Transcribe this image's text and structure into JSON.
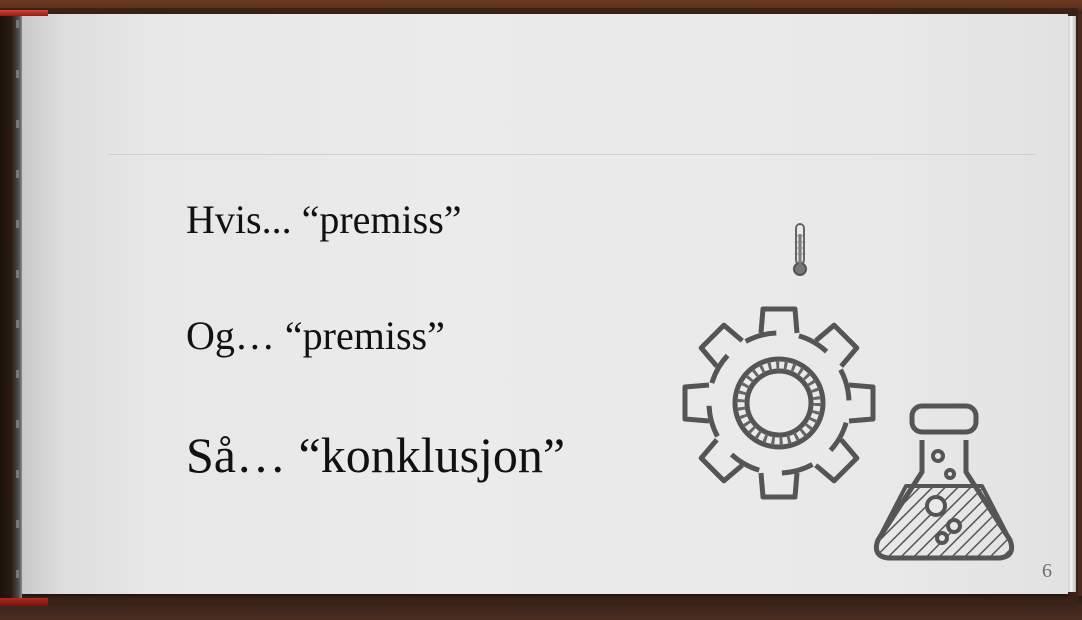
{
  "slide": {
    "lines": [
      "Hvis... “premiss”",
      "Og… “premiss”",
      "Så… “konklusjon”"
    ],
    "page_number": "6"
  },
  "illustrations": [
    "thermometer-icon",
    "gear-icon",
    "flask-icon"
  ],
  "colors": {
    "text": "#111111",
    "sketch": "#555555",
    "page": "#e9e9e9",
    "wood": "#4a2a1c",
    "ribbon": "#b22a24"
  }
}
